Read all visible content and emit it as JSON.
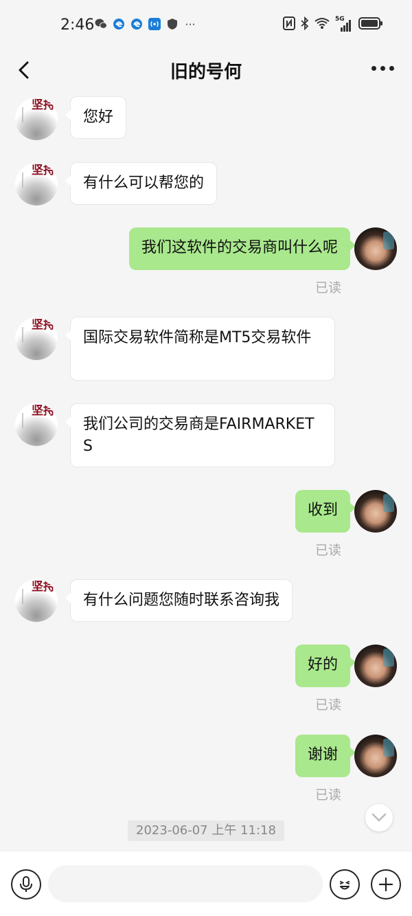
{
  "status_bar": {
    "time": "2:46",
    "left_icons": [
      "wechat-icon",
      "browser-icon",
      "browser-icon",
      "hotspot-icon",
      "shield-icon",
      "more-icon"
    ],
    "right_icons": [
      "nfc-icon",
      "bluetooth-icon",
      "wifi-icon",
      "signal-5g-icon",
      "battery-icon"
    ],
    "signal_label": "5G"
  },
  "header": {
    "title": "旧的号何",
    "back_icon": "chevron-left-icon",
    "more_icon": "more-dots-icon"
  },
  "messages": [
    {
      "side": "left",
      "text": "您好"
    },
    {
      "side": "left",
      "text": "有什么可以帮您的"
    },
    {
      "side": "right",
      "text": "我们这软件的交易商叫什么呢",
      "status": "已读"
    },
    {
      "side": "left",
      "text": "国际交易软件简称是MT5交易软件"
    },
    {
      "side": "left",
      "text": "我们公司的交易商是FAIRMARKETS"
    },
    {
      "side": "right",
      "text": "收到",
      "status": "已读"
    },
    {
      "side": "left",
      "text": "有什么问题您随时联系咨询我"
    },
    {
      "side": "right",
      "text": "好的",
      "status": "已读"
    },
    {
      "side": "right",
      "text": "谢谢",
      "status": "已读"
    }
  ],
  "avatar_text": "坚持",
  "timestamp": "2023-06-07 上午 11:18",
  "input_bar": {
    "voice_icon": "microphone-icon",
    "emoji_icon": "emoji-icon",
    "plus_icon": "plus-icon",
    "placeholder": ""
  },
  "colors": {
    "background": "#f5f5f5",
    "right_bubble": "#a9e88d",
    "left_bubble": "#ffffff",
    "read_text": "#aaaaaa"
  }
}
